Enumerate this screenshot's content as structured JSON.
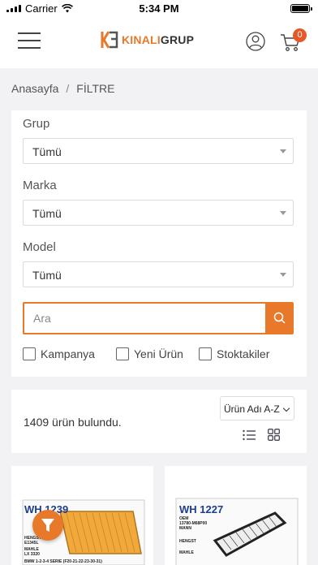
{
  "status_bar": {
    "carrier": "Carrier",
    "time": "5:34 PM",
    "battery_level": 1.0
  },
  "header": {
    "logo_part1": "KINALI",
    "logo_part2": "GRUP",
    "cart_count": "0",
    "accent_color": "#e8792a"
  },
  "breadcrumb": {
    "home": "Anasayfa",
    "separator": "/",
    "current": "FİLTRE"
  },
  "filters": {
    "group_label": "Grup",
    "group_value": "Tümü",
    "brand_label": "Marka",
    "brand_value": "Tümü",
    "model_label": "Model",
    "model_value": "Tümü",
    "search_placeholder": "Ara",
    "checkbox_campaign": "Kampanya",
    "checkbox_new": "Yeni Ürün",
    "checkbox_stock": "Stoktakiler"
  },
  "results": {
    "count_text": "1409 ürün bulundu.",
    "sort_value": "Ürün Adı A-Z"
  },
  "products": [
    {
      "code": "WH 1239",
      "lines": [
        "HENGST",
        "E1345L",
        "MAHLE",
        "LX 3320",
        "BMW 1-2-3-4 SERIE (F20-21-22-23-30-31)"
      ]
    },
    {
      "code": "WH 1227",
      "lines": [
        "OEM",
        "13780-M68P00",
        "MANN",
        "HENGST",
        "MAHLE"
      ]
    }
  ]
}
